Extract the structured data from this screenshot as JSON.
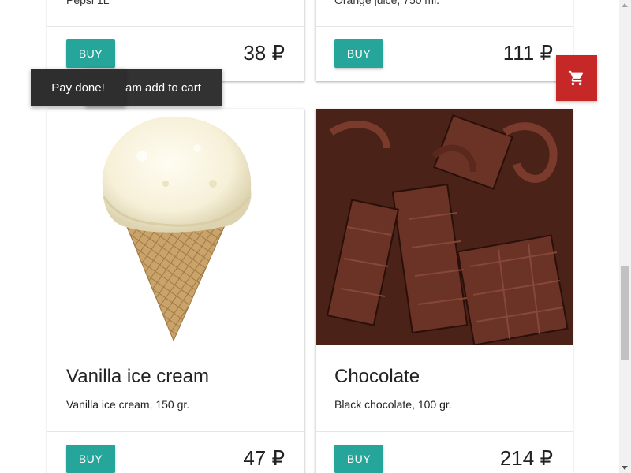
{
  "currency": "₽",
  "colors": {
    "buy_button": "#26a69a",
    "cart_button": "#c62828",
    "toast": "#323232"
  },
  "products_top": [
    {
      "description": "Pepsi 1L",
      "buy_label": "BUY",
      "price": "38 ₽"
    },
    {
      "description": "Orange juice, 750 ml.",
      "buy_label": "BUY",
      "price": "111 ₽"
    }
  ],
  "products_bottom": [
    {
      "title": "Vanilla ice cream",
      "description": "Vanilla ice cream, 150 gr.",
      "buy_label": "BUY",
      "price": "47 ₽",
      "image": "ice-cream-cone"
    },
    {
      "title": "Chocolate",
      "description": "Black chocolate, 100 gr.",
      "buy_label": "BUY",
      "price": "214 ₽",
      "image": "chocolate-pieces"
    }
  ],
  "cart": {
    "icon": "shopping-cart-icon"
  },
  "toasts": [
    {
      "text": "am add to cart"
    },
    {
      "text": "Pay done!"
    }
  ]
}
